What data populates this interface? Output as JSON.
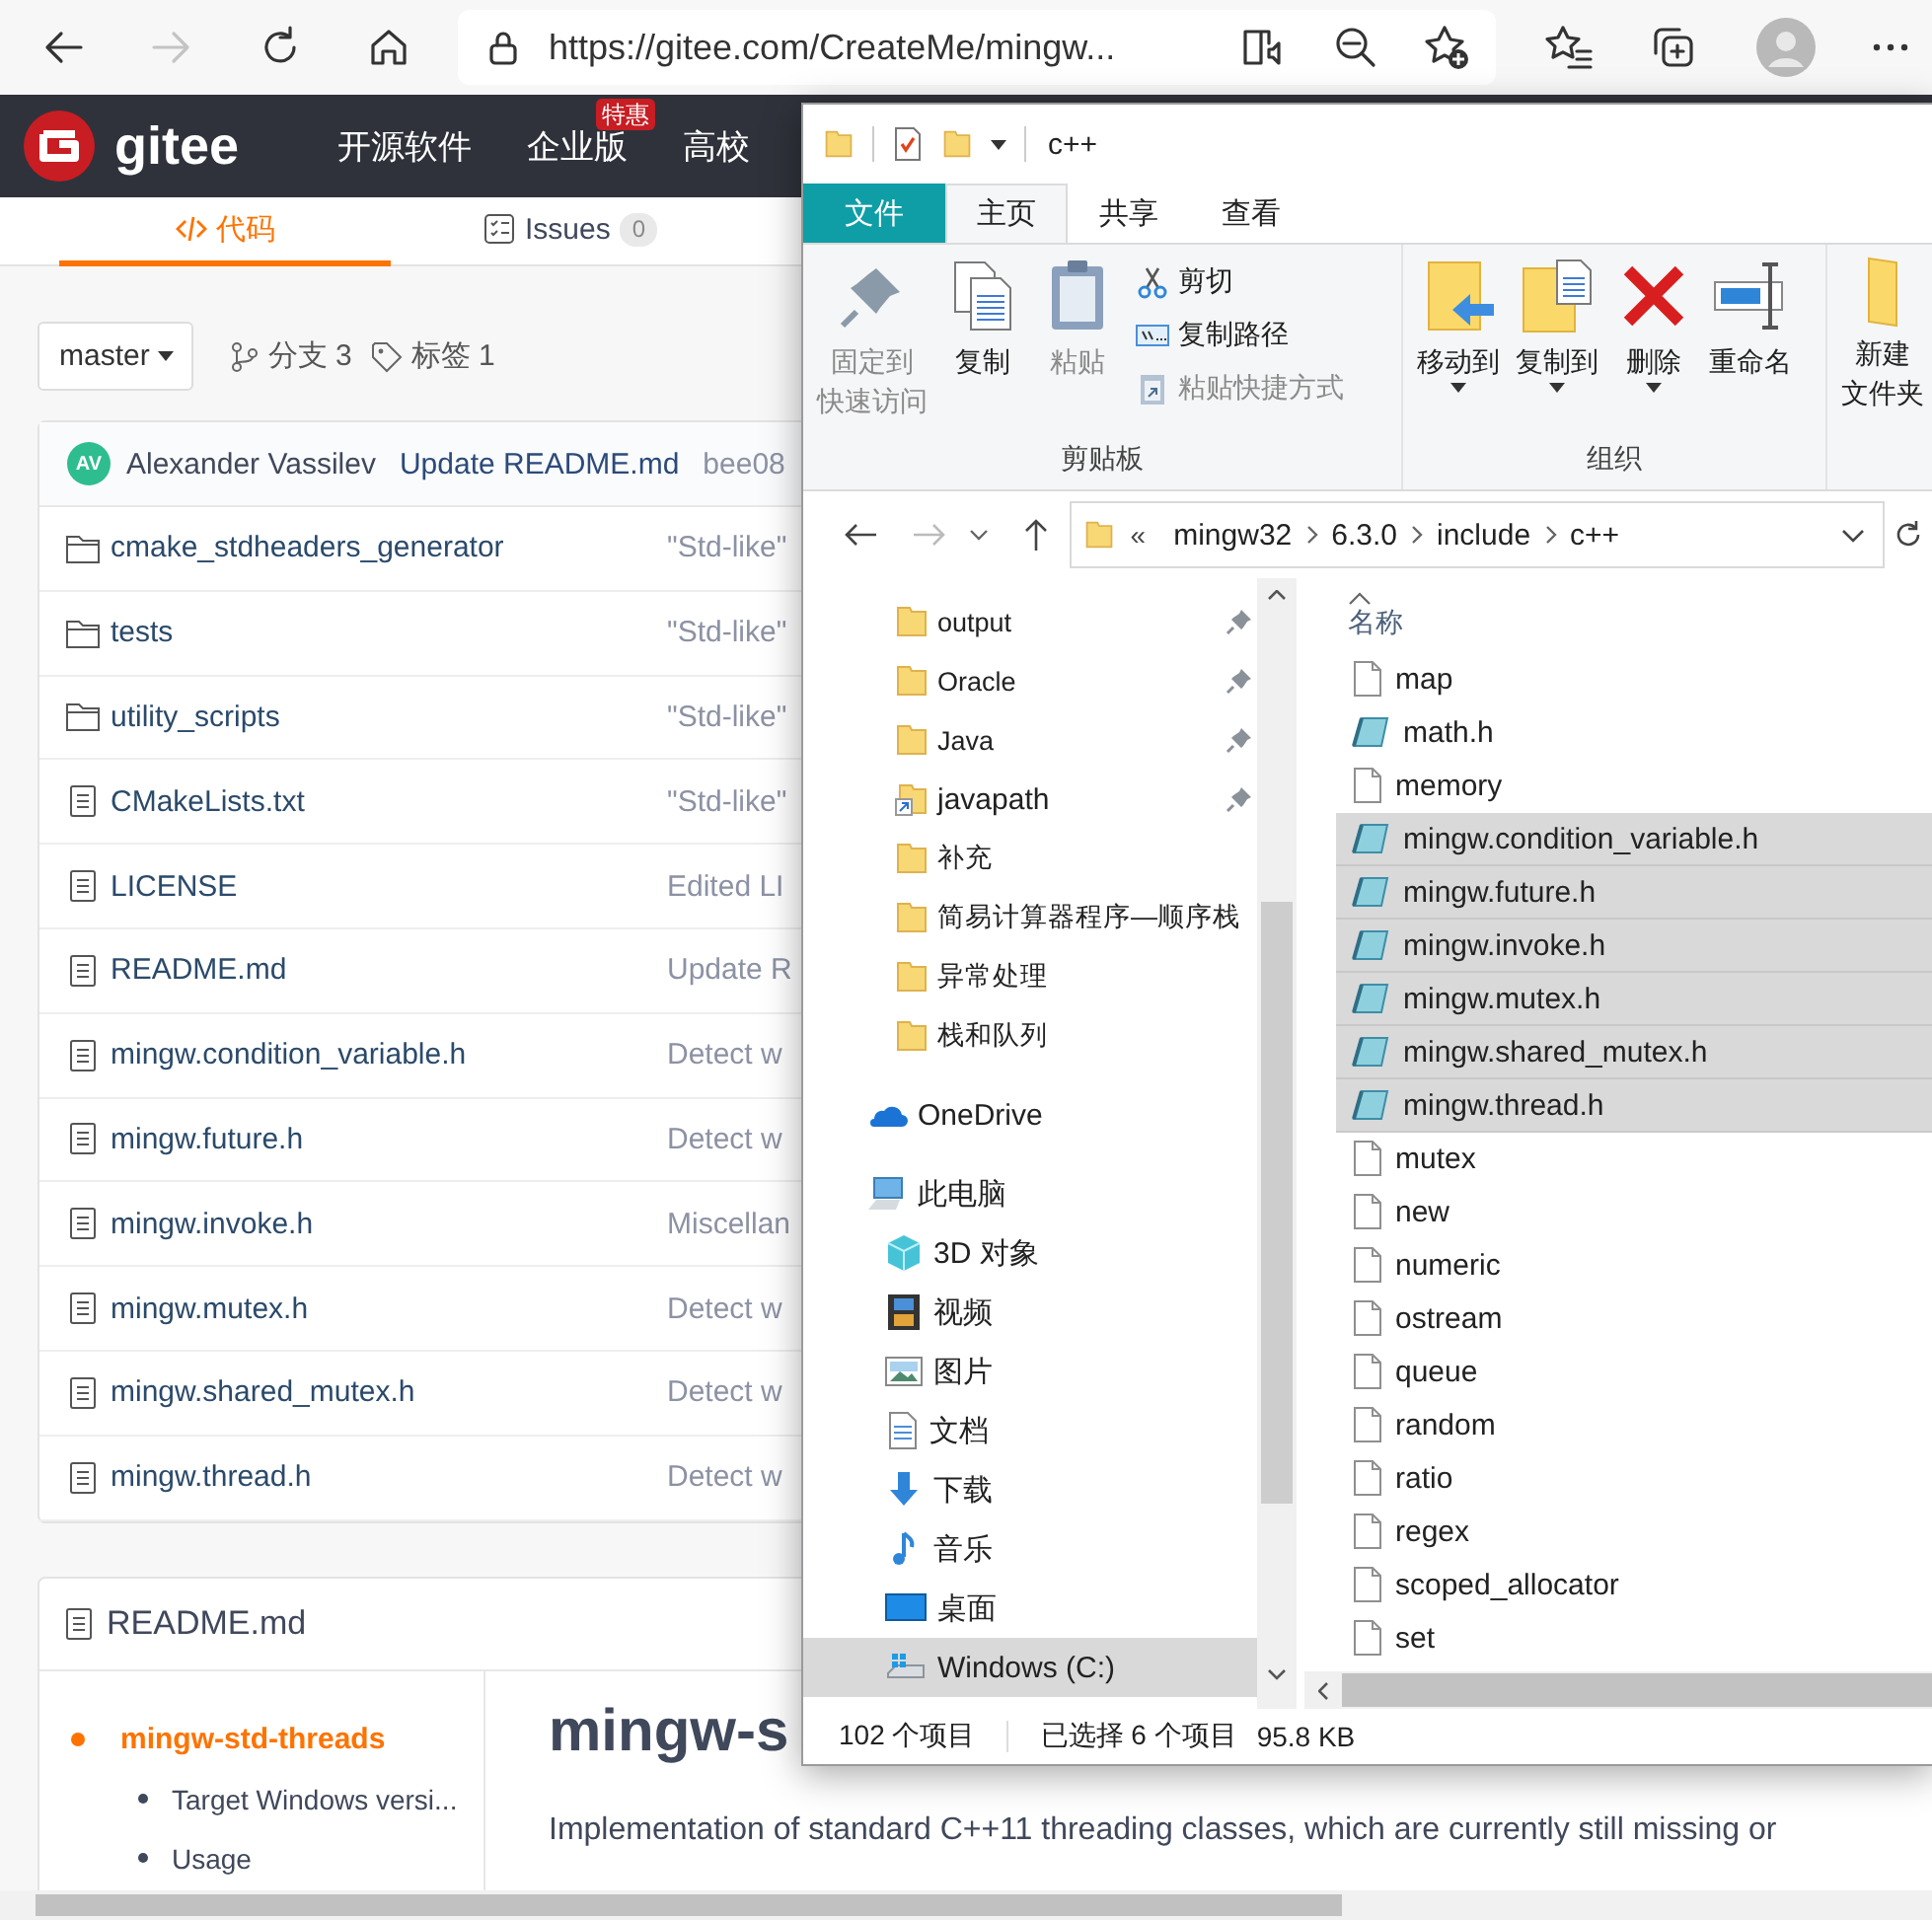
{
  "browser": {
    "url": "https://gitee.com/CreateMe/mingw..."
  },
  "site_header": {
    "logo": "gitee",
    "nav": [
      {
        "label": "开源软件"
      },
      {
        "label": "企业版",
        "badge": "特惠"
      },
      {
        "label": "高校"
      }
    ]
  },
  "repo_tabs": [
    {
      "label": "代码",
      "selected": true
    },
    {
      "label": "Issues",
      "count": "0",
      "selected": false
    }
  ],
  "branch_bar": {
    "branch": "master",
    "branches": "分支 3",
    "tags": "标签 1"
  },
  "last_commit": {
    "avatar": "AV",
    "author": "Alexander Vassilev",
    "message": "Update README.md",
    "hash": "bee08"
  },
  "files": [
    {
      "name": "cmake_stdheaders_generator",
      "kind": "folder",
      "message": "\"Std-like\""
    },
    {
      "name": "tests",
      "kind": "folder",
      "message": "\"Std-like\""
    },
    {
      "name": "utility_scripts",
      "kind": "folder",
      "message": "\"Std-like\""
    },
    {
      "name": "CMakeLists.txt",
      "kind": "file",
      "message": "\"Std-like\""
    },
    {
      "name": "LICENSE",
      "kind": "file",
      "message": "Edited LI"
    },
    {
      "name": "README.md",
      "kind": "file",
      "message": "Update R"
    },
    {
      "name": "mingw.condition_variable.h",
      "kind": "file",
      "message": "Detect w"
    },
    {
      "name": "mingw.future.h",
      "kind": "file",
      "message": "Detect w"
    },
    {
      "name": "mingw.invoke.h",
      "kind": "file",
      "message": "Miscellan"
    },
    {
      "name": "mingw.mutex.h",
      "kind": "file",
      "message": "Detect w"
    },
    {
      "name": "mingw.shared_mutex.h",
      "kind": "file",
      "message": "Detect w"
    },
    {
      "name": "mingw.thread.h",
      "kind": "file",
      "message": "Detect w"
    }
  ],
  "readme": {
    "title": "README.md",
    "toc": [
      {
        "label": "mingw-std-threads",
        "selected": true,
        "children": [
          {
            "label": "Target Windows versi...",
            "selected": false
          },
          {
            "label": "Usage",
            "selected": false
          }
        ]
      }
    ],
    "heading": "mingw-s",
    "intro": "Implementation of standard C++11 threading classes, which are currently still missing or"
  },
  "explorer": {
    "title": "c++",
    "ribbon_tabs": [
      {
        "label": "文件",
        "kind": "menu",
        "selected": false
      },
      {
        "label": "主页",
        "kind": "tab",
        "selected": true
      },
      {
        "label": "共享",
        "kind": "tab",
        "selected": false
      },
      {
        "label": "查看",
        "kind": "tab",
        "selected": false
      }
    ],
    "ribbon_groups": [
      {
        "label": "剪贴板",
        "commands": [
          {
            "lines": [
              "固定到",
              "快速访问"
            ],
            "kind": "pin",
            "disabled": true
          },
          {
            "lines": [
              "复制"
            ],
            "kind": "copy",
            "disabled": false
          },
          {
            "lines": [
              "粘贴"
            ],
            "kind": "paste",
            "disabled": true
          },
          {
            "kind": "stack",
            "commands": [
              {
                "lines": [
                  "剪切"
                ],
                "kind": "cut",
                "disabled": false
              },
              {
                "lines": [
                  "复制路径"
                ],
                "kind": "copy_path",
                "disabled": false
              },
              {
                "lines": [
                  "粘贴快捷方式"
                ],
                "kind": "paste_shortcut",
                "disabled": true
              }
            ]
          }
        ]
      },
      {
        "label": "组织",
        "commands": [
          {
            "lines": [
              "移动到"
            ],
            "kind": "move_to",
            "disabled": false,
            "dropdown": true
          },
          {
            "lines": [
              "复制到"
            ],
            "kind": "copy_to",
            "disabled": false,
            "dropdown": true
          },
          {
            "lines": [
              "删除"
            ],
            "kind": "delete",
            "disabled": false,
            "dropdown": true
          },
          {
            "lines": [
              "重命名"
            ],
            "kind": "rename",
            "disabled": false
          }
        ]
      },
      {
        "commands": [
          {
            "lines": [
              "新建",
              "文件夹"
            ],
            "kind": "new_folder",
            "disabled": false
          }
        ]
      }
    ],
    "address": {
      "back_enabled": true,
      "forward_enabled": false,
      "overflow": "«",
      "path": [
        "mingw32",
        "6.3.0",
        "include",
        "c++"
      ]
    },
    "nav": [
      {
        "label": "output",
        "kind": "folder",
        "pinned": true,
        "selected": false
      },
      {
        "label": "Oracle",
        "kind": "folder",
        "pinned": true,
        "selected": false
      },
      {
        "label": "Java",
        "kind": "folder",
        "pinned": true,
        "selected": false
      },
      {
        "label": "javapath",
        "kind": "shortcut",
        "pinned": true,
        "selected": false
      },
      {
        "label": "补充",
        "kind": "folder",
        "selected": false
      },
      {
        "label": "简易计算器程序—顺序栈",
        "kind": "folder",
        "selected": false
      },
      {
        "label": "异常处理",
        "kind": "folder",
        "selected": false
      },
      {
        "label": "栈和队列",
        "kind": "folder",
        "selected": false
      },
      {
        "label": "OneDrive",
        "kind": "onedrive",
        "selected": false
      },
      {
        "label": "此电脑",
        "kind": "computer",
        "selected": false,
        "children": [
          {
            "label": "3D 对象",
            "kind": "cube",
            "selected": false
          },
          {
            "label": "视频",
            "kind": "video",
            "selected": false
          },
          {
            "label": "图片",
            "kind": "pictures",
            "selected": false
          },
          {
            "label": "文档",
            "kind": "documents",
            "selected": false
          },
          {
            "label": "下载",
            "kind": "downloads",
            "selected": false
          },
          {
            "label": "音乐",
            "kind": "music",
            "selected": false
          },
          {
            "label": "桌面",
            "kind": "desktop",
            "selected": false
          },
          {
            "label": "Windows (C:)",
            "kind": "drive",
            "selected": true
          }
        ]
      }
    ],
    "list_header": "名称",
    "items": [
      {
        "name": "map",
        "kind": "file",
        "selected": false
      },
      {
        "name": "math.h",
        "kind": "header",
        "selected": false
      },
      {
        "name": "memory",
        "kind": "file",
        "selected": false
      },
      {
        "name": "mingw.condition_variable.h",
        "kind": "header",
        "selected": true
      },
      {
        "name": "mingw.future.h",
        "kind": "header",
        "selected": true
      },
      {
        "name": "mingw.invoke.h",
        "kind": "header",
        "selected": true
      },
      {
        "name": "mingw.mutex.h",
        "kind": "header",
        "selected": true
      },
      {
        "name": "mingw.shared_mutex.h",
        "kind": "header",
        "selected": true
      },
      {
        "name": "mingw.thread.h",
        "kind": "header",
        "selected": true
      },
      {
        "name": "mutex",
        "kind": "file",
        "selected": false
      },
      {
        "name": "new",
        "kind": "file",
        "selected": false
      },
      {
        "name": "numeric",
        "kind": "file",
        "selected": false
      },
      {
        "name": "ostream",
        "kind": "file",
        "selected": false
      },
      {
        "name": "queue",
        "kind": "file",
        "selected": false
      },
      {
        "name": "random",
        "kind": "file",
        "selected": false
      },
      {
        "name": "ratio",
        "kind": "file",
        "selected": false
      },
      {
        "name": "regex",
        "kind": "file",
        "selected": false
      },
      {
        "name": "scoped_allocator",
        "kind": "file",
        "selected": false
      },
      {
        "name": "set",
        "kind": "file",
        "selected": false
      }
    ],
    "status": {
      "count": "102 个项目",
      "selection": "已选择 6 个项目",
      "size": "95.8 KB"
    }
  }
}
